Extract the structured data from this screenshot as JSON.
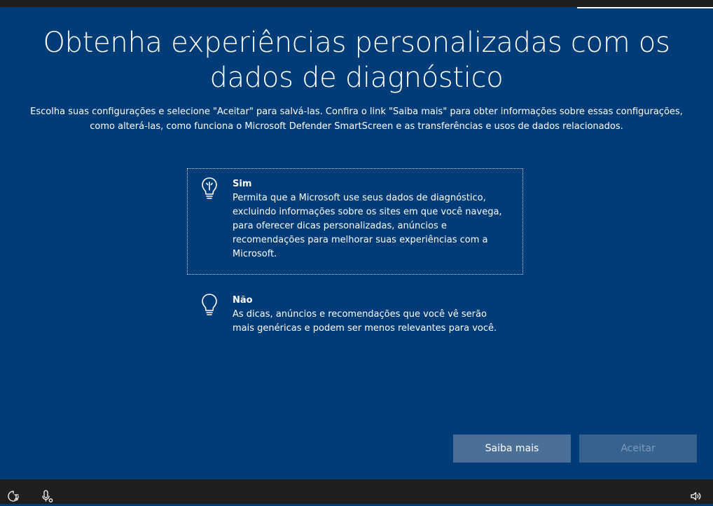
{
  "title": "Obtenha experiências personalizadas com os dados de diagnóstico",
  "subtitle": "Escolha suas configurações e selecione \"Aceitar\" para salvá-las. Confira o link \"Saiba mais\" para obter informações sobre essas configurações, como alterá-las, como funciona o Microsoft Defender SmartScreen e as transferências e usos de dados relacionados.",
  "options": [
    {
      "title": "Sim",
      "description": "Permita que a Microsoft use seus dados de diagnóstico, excluindo informações sobre os sites em que você navega, para oferecer dicas personalizadas, anúncios e recomendações para melhorar suas experiências com a Microsoft.",
      "icon": "lightbulb-on-icon",
      "selected": true
    },
    {
      "title": "Não",
      "description": "As dicas, anúncios e recomendações que você vê serão mais genéricas e podem ser menos relevantes para você.",
      "icon": "lightbulb-off-icon",
      "selected": false
    }
  ],
  "buttons": {
    "learn_more": "Saiba mais",
    "accept": "Aceitar",
    "accept_enabled": false
  },
  "taskbar": {
    "left_icons": [
      "ease-of-access-icon",
      "microphone-icon"
    ],
    "right_icons": [
      "volume-icon"
    ]
  },
  "colors": {
    "background": "#003c78",
    "button_primary": "#4a7098",
    "button_disabled": "#35628e",
    "bar": "#1f1f1f"
  }
}
